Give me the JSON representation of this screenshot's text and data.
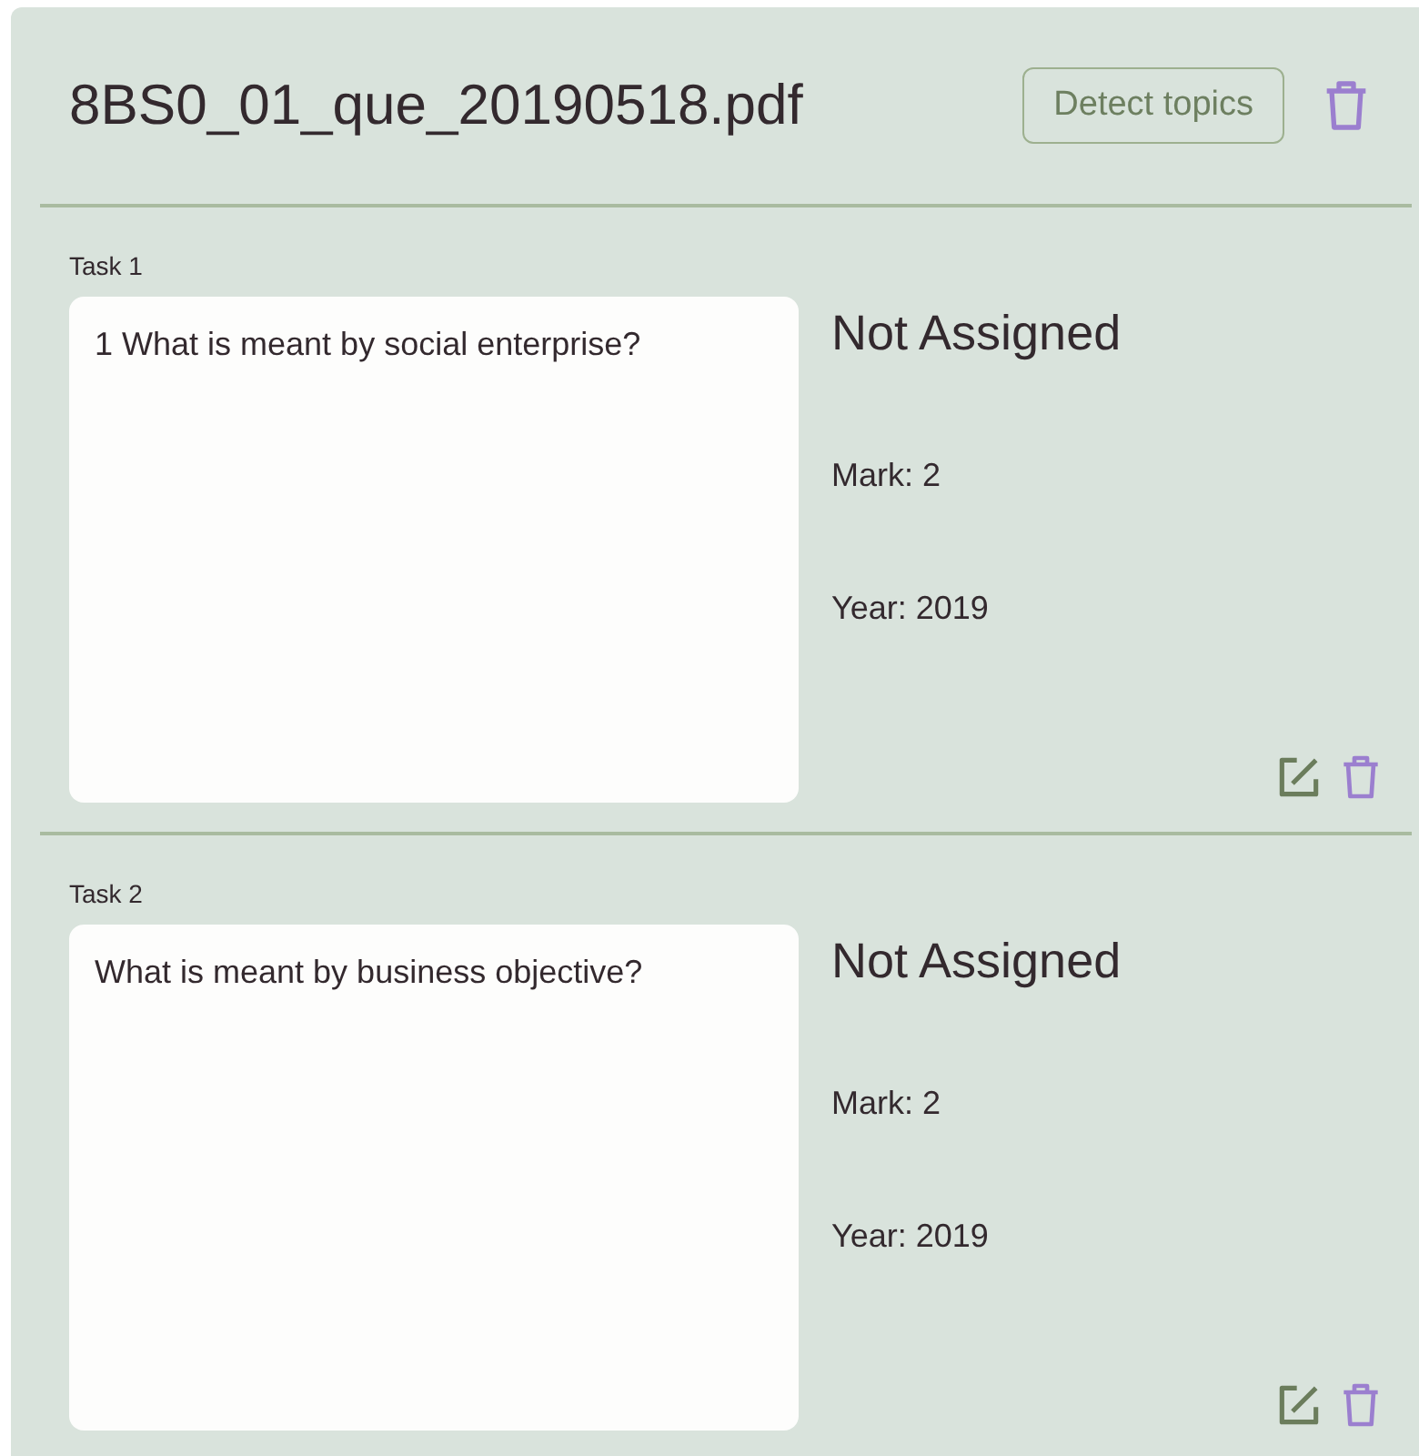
{
  "file": {
    "title": "8BS0_01_que_20190518.pdf",
    "detect_button": "Detect topics"
  },
  "tasks": [
    {
      "label": "Task 1",
      "question": "1 What is meant by social enterprise?",
      "status": "Not Assigned",
      "mark": "Mark: 2",
      "year": "Year: 2019"
    },
    {
      "label": "Task 2",
      "question": "What is meant by business objective?",
      "status": "Not Assigned",
      "mark": "Mark: 2",
      "year": "Year: 2019"
    }
  ]
}
